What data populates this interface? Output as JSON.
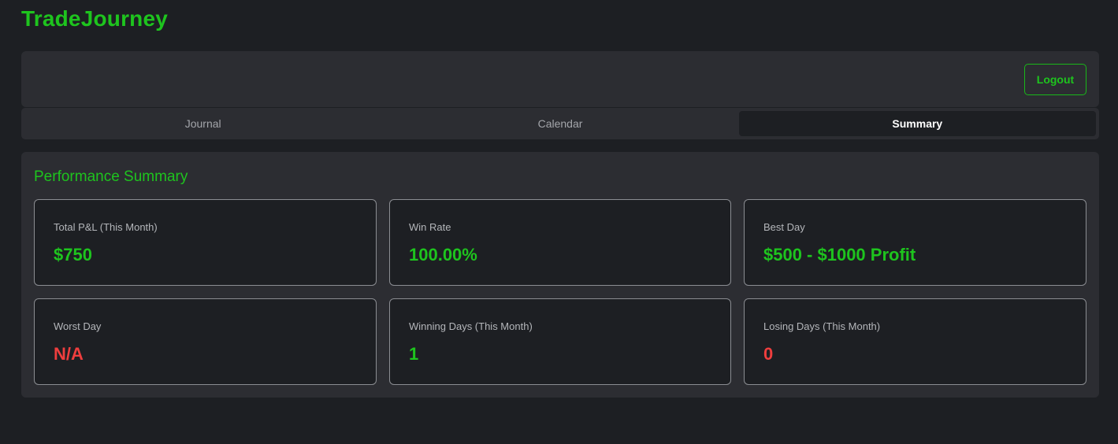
{
  "app": {
    "title": "TradeJourney"
  },
  "header": {
    "logout_label": "Logout"
  },
  "tabs": [
    {
      "label": "Journal",
      "active": false
    },
    {
      "label": "Calendar",
      "active": false
    },
    {
      "label": "Summary",
      "active": true
    }
  ],
  "summary": {
    "title": "Performance Summary",
    "cards": [
      {
        "label": "Total P&L (This Month)",
        "value": "$750",
        "tone": "positive"
      },
      {
        "label": "Win Rate",
        "value": "100.00%",
        "tone": "positive"
      },
      {
        "label": "Best Day",
        "value": "$500 - $1000 Profit",
        "tone": "positive"
      },
      {
        "label": "Worst Day",
        "value": "N/A",
        "tone": "negative"
      },
      {
        "label": "Winning Days (This Month)",
        "value": "1",
        "tone": "positive"
      },
      {
        "label": "Losing Days (This Month)",
        "value": "0",
        "tone": "negative"
      }
    ]
  },
  "colors": {
    "accent": "#1ec41e",
    "negative": "#ef3e3e",
    "background": "#1d1f23",
    "panel": "#2c2d32"
  }
}
